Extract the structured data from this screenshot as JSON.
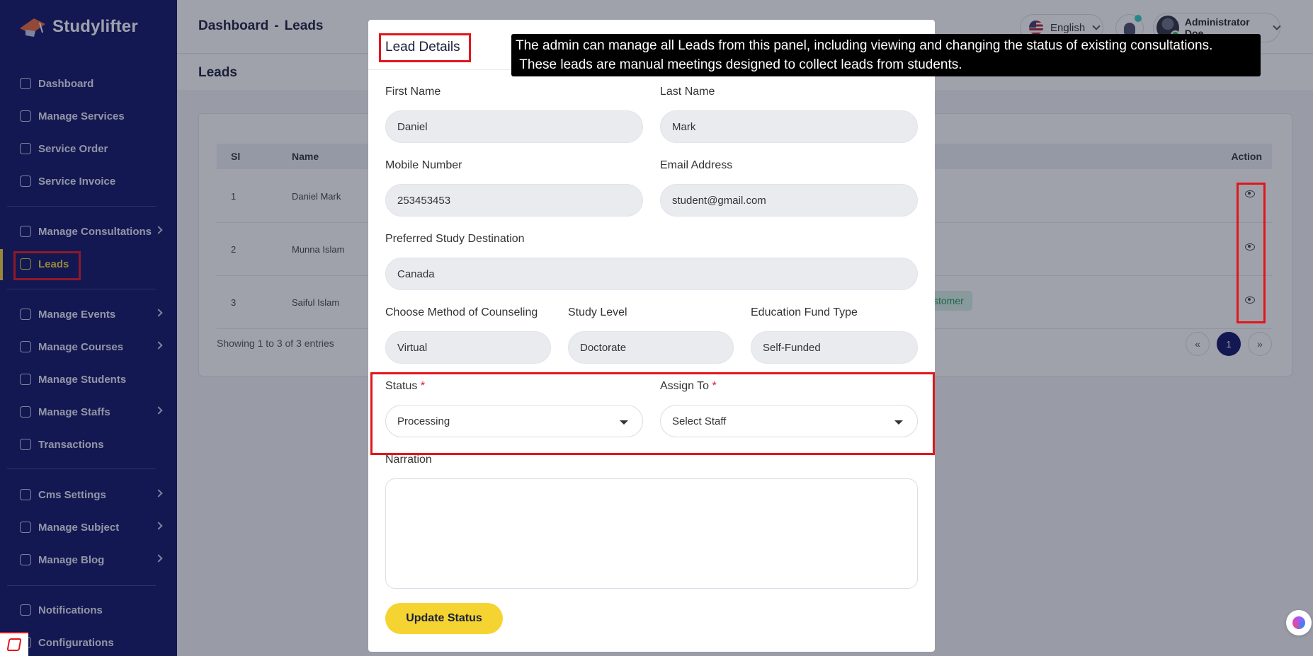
{
  "app": {
    "brand": "Studylifter"
  },
  "sidebar": {
    "items": [
      {
        "label": "Dashboard",
        "icon": "dashboard-icon"
      },
      {
        "label": "Manage Services",
        "icon": "services-icon"
      },
      {
        "label": "Service Order",
        "icon": "list-icon"
      },
      {
        "label": "Service Invoice",
        "icon": "invoice-icon"
      },
      {
        "label": "Manage Consultations",
        "icon": "consultations-icon",
        "has_submenu": true
      },
      {
        "label": "Leads",
        "icon": "leads-icon",
        "active": true
      },
      {
        "label": "Manage Events",
        "icon": "calendar-icon",
        "has_submenu": true
      },
      {
        "label": "Manage Courses",
        "icon": "courses-icon",
        "has_submenu": true
      },
      {
        "label": "Manage Students",
        "icon": "students-icon"
      },
      {
        "label": "Manage Staffs",
        "icon": "staffs-icon",
        "has_submenu": true
      },
      {
        "label": "Transactions",
        "icon": "transactions-icon"
      },
      {
        "label": "Cms Settings",
        "icon": "settings-icon",
        "has_submenu": true
      },
      {
        "label": "Manage Subject",
        "icon": "book-icon",
        "has_submenu": true
      },
      {
        "label": "Manage Blog",
        "icon": "blog-icon",
        "has_submenu": true
      },
      {
        "label": "Notifications",
        "icon": "bell-icon"
      },
      {
        "label": "Configurations",
        "icon": "config-icon"
      }
    ]
  },
  "header": {
    "breadcrumb_root": "Dashboard",
    "breadcrumb_sep": "-",
    "breadcrumb_current": "Leads",
    "language": "English",
    "user_name": "Administrator Doe"
  },
  "page": {
    "title": "Leads",
    "table": {
      "headers": [
        "Sl",
        "Name",
        "Action"
      ],
      "rows": [
        {
          "sl": "1",
          "name": "Daniel Mark"
        },
        {
          "sl": "2",
          "name": "Munna Islam"
        },
        {
          "sl": "3",
          "name": "Saiful Islam"
        }
      ],
      "partial_badge": "stomer"
    },
    "showing": "Showing 1 to 3 of 3 entries",
    "pagination": {
      "prev": "«",
      "current": "1",
      "next": "»"
    }
  },
  "modal": {
    "title": "Lead Details",
    "fields": {
      "first_name": {
        "label": "First Name",
        "value": "Daniel"
      },
      "last_name": {
        "label": "Last Name",
        "value": "Mark"
      },
      "mobile": {
        "label": "Mobile Number",
        "value": "253453453"
      },
      "email": {
        "label": "Email Address",
        "value": "student@gmail.com"
      },
      "destination": {
        "label": "Preferred Study Destination",
        "value": "Canada"
      },
      "method": {
        "label": "Choose Method of Counseling",
        "value": "Virtual"
      },
      "level": {
        "label": "Study Level",
        "value": "Doctorate"
      },
      "fund": {
        "label": "Education Fund Type",
        "value": "Self-Funded"
      },
      "status": {
        "label": "Status",
        "value": "Processing",
        "required": "*"
      },
      "assign": {
        "label": "Assign To",
        "value": "Select Staff",
        "required": "*"
      },
      "narration": {
        "label": "Narration",
        "value": ""
      }
    },
    "submit_label": "Update Status"
  },
  "tooltip": {
    "text": "The admin can manage all Leads from this panel, including viewing and changing the status of existing consultations.\n These leads are manual meetings designed to collect leads from students."
  },
  "colors": {
    "sidebar_bg": "#0f1367",
    "accent": "#f5d431",
    "highlight": "#e3151c",
    "badge_green": "#27985c"
  }
}
